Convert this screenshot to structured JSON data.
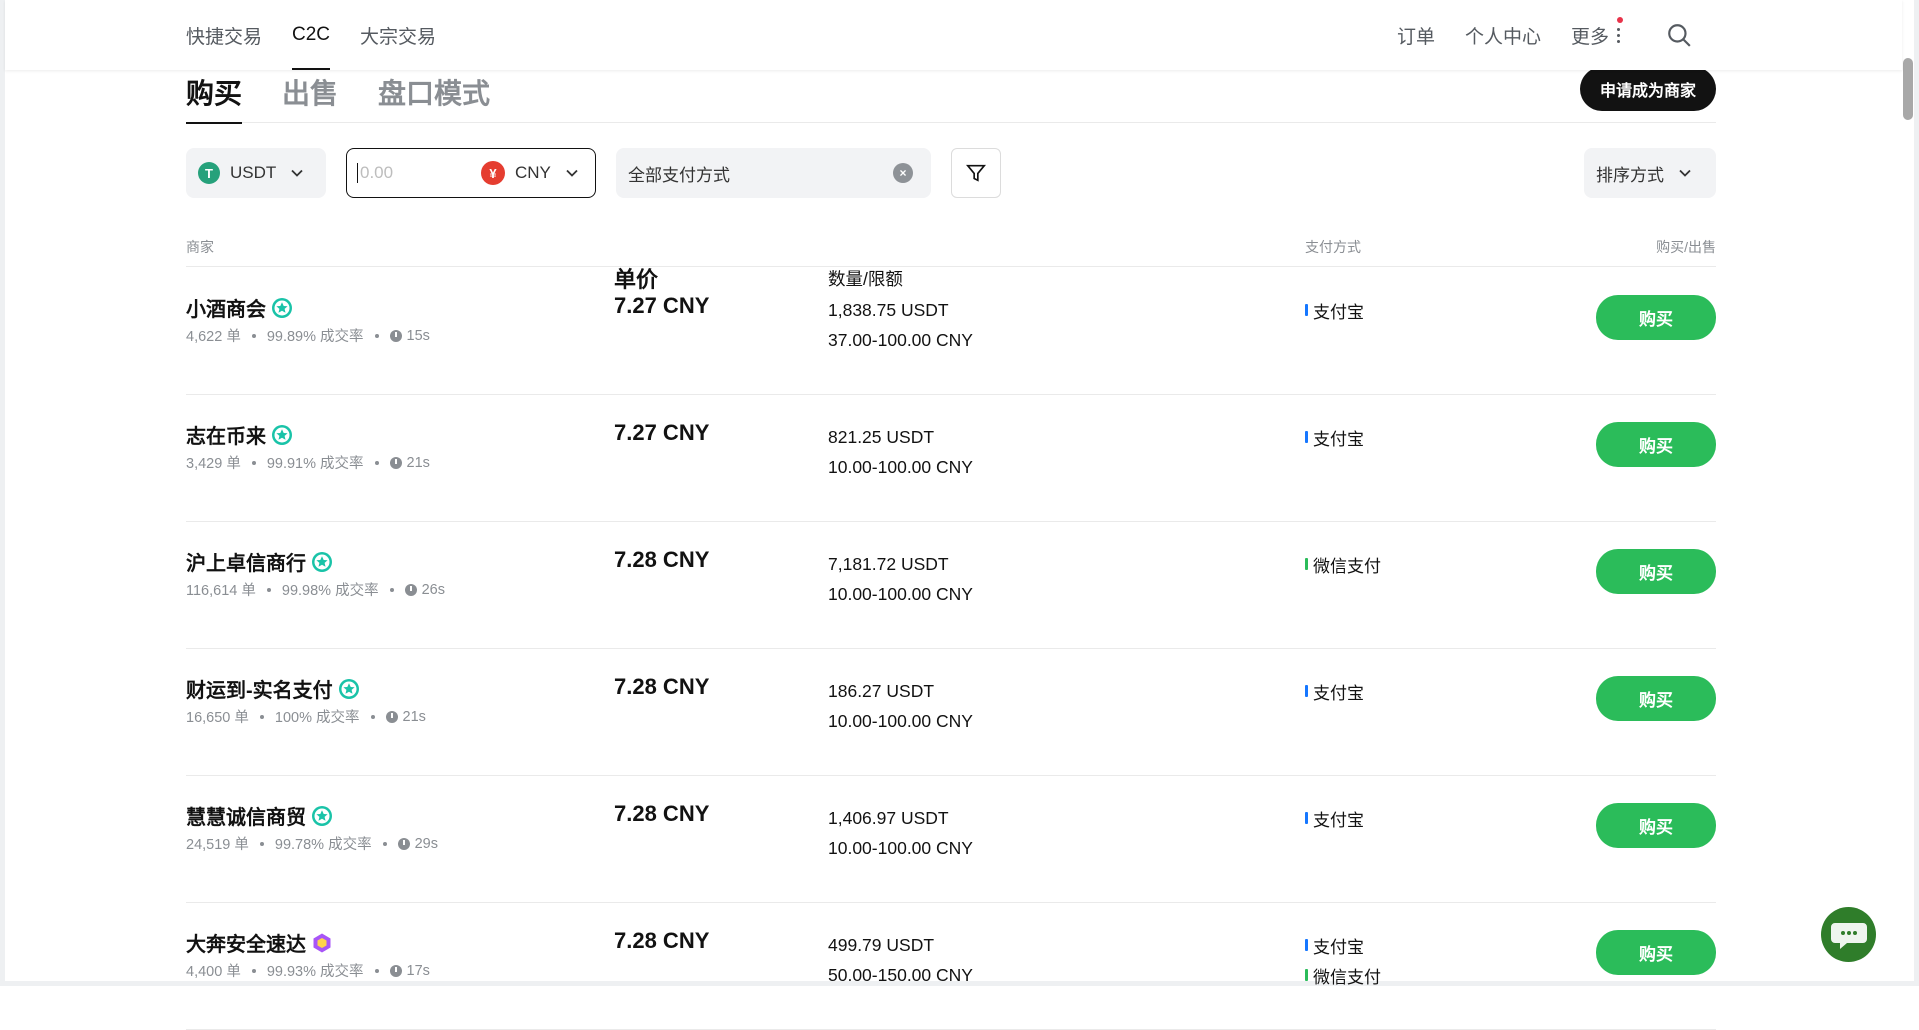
{
  "nav": {
    "left": [
      {
        "label": "快捷交易",
        "active": false
      },
      {
        "label": "C2C",
        "active": true
      },
      {
        "label": "大宗交易",
        "active": false
      }
    ],
    "orders": "订单",
    "profile": "个人中心",
    "more": "更多"
  },
  "tabs": [
    {
      "label": "购买",
      "active": true
    },
    {
      "label": "出售",
      "active": false
    },
    {
      "label": "盘口模式",
      "active": false
    }
  ],
  "apply_merchant": "申请成为商家",
  "filters": {
    "coin": "USDT",
    "amount_placeholder": "0.00",
    "currency": "CNY",
    "currency_symbol": "¥",
    "payment": "全部支付方式",
    "sort": "排序方式"
  },
  "table_headers": {
    "merchant": "商家",
    "price": "单价",
    "qty": "数量/限额",
    "payment": "支付方式",
    "action": "购买/出售"
  },
  "rows": [
    {
      "name": "小酒商会",
      "orders": "4,622 单",
      "rate": "99.89% 成交率",
      "time": "15s",
      "price": "7.27 CNY",
      "amount": "1,838.75 USDT",
      "limit": "37.00-100.00 CNY",
      "pay": [
        {
          "label": "支付宝",
          "color": "#1677ff"
        }
      ],
      "action": "购买",
      "badge": "verified-star"
    },
    {
      "name": "志在币来",
      "orders": "3,429 单",
      "rate": "99.91% 成交率",
      "time": "21s",
      "price": "7.27 CNY",
      "amount": "821.25 USDT",
      "limit": "10.00-100.00 CNY",
      "pay": [
        {
          "label": "支付宝",
          "color": "#1677ff"
        }
      ],
      "action": "购买",
      "badge": "verified-star"
    },
    {
      "name": "沪上卓信商行",
      "orders": "116,614 单",
      "rate": "99.98% 成交率",
      "time": "26s",
      "price": "7.28 CNY",
      "amount": "7,181.72 USDT",
      "limit": "10.00-100.00 CNY",
      "pay": [
        {
          "label": "微信支付",
          "color": "#2bbc5a"
        }
      ],
      "action": "购买",
      "badge": "verified-star"
    },
    {
      "name": "财运到-实名支付",
      "orders": "16,650 单",
      "rate": "100% 成交率",
      "time": "21s",
      "price": "7.28 CNY",
      "amount": "186.27 USDT",
      "limit": "10.00-100.00 CNY",
      "pay": [
        {
          "label": "支付宝",
          "color": "#1677ff"
        }
      ],
      "action": "购买",
      "badge": "verified-star"
    },
    {
      "name": "慧慧诚信商贸",
      "orders": "24,519 单",
      "rate": "99.78% 成交率",
      "time": "29s",
      "price": "7.28 CNY",
      "amount": "1,406.97 USDT",
      "limit": "10.00-100.00 CNY",
      "pay": [
        {
          "label": "支付宝",
          "color": "#1677ff"
        }
      ],
      "action": "购买",
      "badge": "verified-star"
    },
    {
      "name": "大奔安全速达",
      "orders": "4,400 单",
      "rate": "99.93% 成交率",
      "time": "17s",
      "price": "7.28 CNY",
      "amount": "499.79 USDT",
      "limit": "50.00-150.00 CNY",
      "pay": [
        {
          "label": "支付宝",
          "color": "#1677ff"
        },
        {
          "label": "微信支付",
          "color": "#2bbc5a"
        }
      ],
      "action": "购买",
      "badge": "diamond"
    }
  ],
  "colors": {
    "accent_green": "#2bbc5a",
    "badge_teal": "#19c3a8",
    "badge_purple": "#a855f7",
    "tether": "#26a17b",
    "yuan": "#e53d30"
  }
}
